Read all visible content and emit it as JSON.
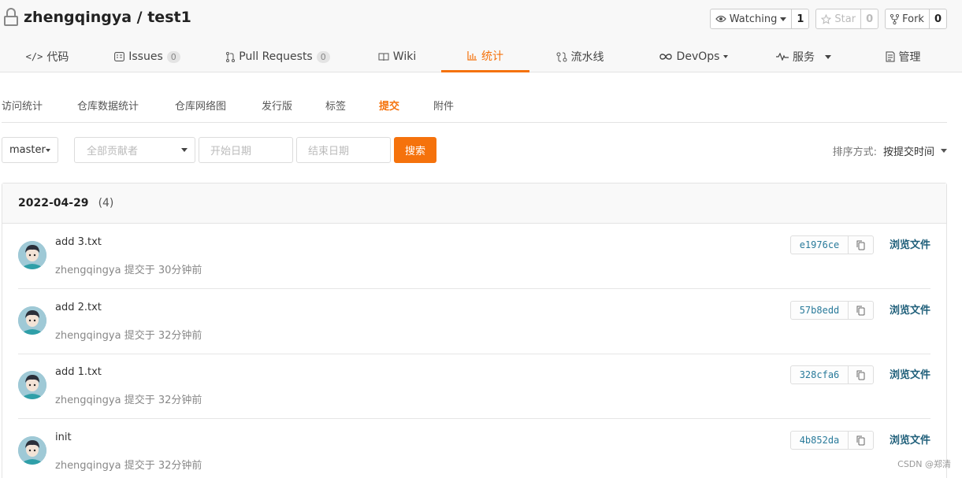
{
  "repo": {
    "owner": "zhengqingya",
    "separator": " / ",
    "name": "test1"
  },
  "header_buttons": {
    "watch": {
      "label": "Watching",
      "count": "1"
    },
    "star": {
      "label": "Star",
      "count": "0"
    },
    "fork": {
      "label": "Fork",
      "count": "0"
    }
  },
  "nav": {
    "items": [
      {
        "label": "代码"
      },
      {
        "label": "Issues",
        "badge": "0"
      },
      {
        "label": "Pull Requests",
        "badge": "0"
      },
      {
        "label": "Wiki"
      },
      {
        "label": "统计",
        "active": true
      },
      {
        "label": "流水线"
      },
      {
        "label": "DevOps"
      },
      {
        "label": "服务"
      },
      {
        "label": "管理"
      }
    ]
  },
  "subtabs": [
    "访问统计",
    "仓库数据统计",
    "仓库网络图",
    "发行版",
    "标签",
    "提交",
    "附件"
  ],
  "filters": {
    "branch": "master",
    "contributors_placeholder": "全部贡献者",
    "start_date_placeholder": "开始日期",
    "end_date_placeholder": "结束日期",
    "search_label": "搜索",
    "sort_key": "排序方式:",
    "sort_value": "按提交时间"
  },
  "commit_group": {
    "date": "2022-04-29",
    "count": "(4)"
  },
  "commits": [
    {
      "message": "add 3.txt",
      "meta": "zhengqingya 提交于 30分钟前",
      "sha": "e1976ce",
      "browse": "浏览文件"
    },
    {
      "message": "add 2.txt",
      "meta": "zhengqingya 提交于 32分钟前",
      "sha": "57b8edd",
      "browse": "浏览文件"
    },
    {
      "message": "add 1.txt",
      "meta": "zhengqingya 提交于 32分钟前",
      "sha": "328cfa6",
      "browse": "浏览文件"
    },
    {
      "message": "init",
      "meta": "zhengqingya 提交于 32分钟前",
      "sha": "4b852da",
      "browse": "浏览文件"
    }
  ],
  "watermark": "CSDN @郑清",
  "colors": {
    "accent": "#f5720c",
    "link": "#1f5f7a",
    "sha": "#2a7b9b"
  }
}
